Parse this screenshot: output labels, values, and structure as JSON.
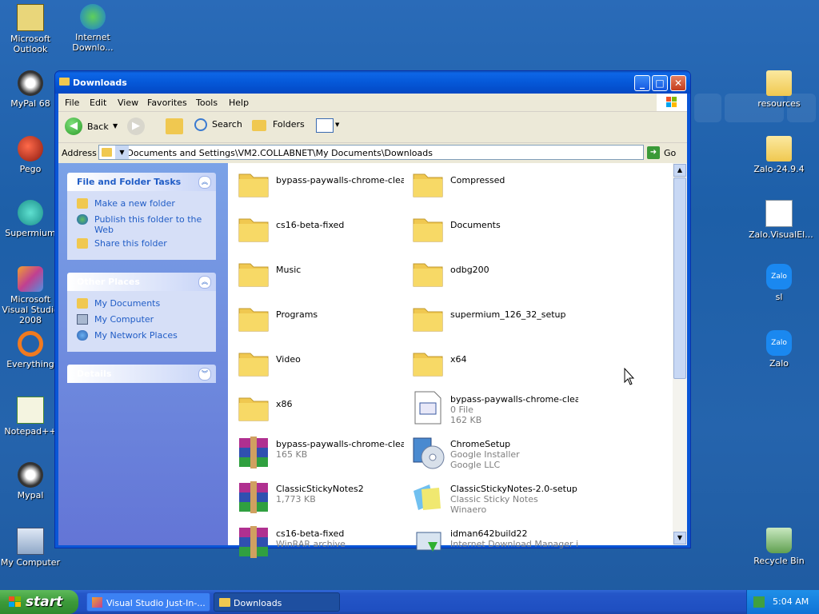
{
  "desktop": {
    "icons_left": [
      {
        "label": "Microsoft Outlook"
      },
      {
        "label": "Internet Downlo..."
      },
      {
        "label": "MyPal 68"
      },
      {
        "label": "Pego"
      },
      {
        "label": "Supermium"
      },
      {
        "label": "Microsoft Visual Studio 2008"
      },
      {
        "label": "Everything"
      },
      {
        "label": "Notepad++"
      },
      {
        "label": "Mypal"
      },
      {
        "label": "My Computer"
      }
    ],
    "icons_right": [
      {
        "label": "resources"
      },
      {
        "label": "Zalo-24.9.4"
      },
      {
        "label": "Zalo.VisualEl..."
      },
      {
        "label": "sl"
      },
      {
        "label": "Zalo"
      },
      {
        "label": "Recycle Bin"
      }
    ],
    "zalo_badge": "Zalo"
  },
  "window": {
    "title": "Downloads",
    "buttons": {
      "minimize": "_",
      "maximize": "□",
      "close": "✕"
    },
    "menu": [
      "File",
      "Edit",
      "View",
      "Favorites",
      "Tools",
      "Help"
    ],
    "toolbar": {
      "back": "Back",
      "search": "Search",
      "folders": "Folders"
    },
    "address": {
      "label": "Address",
      "value": "E:\\Documents and Settings\\VM2.COLLABNET\\My Documents\\Downloads",
      "go": "Go"
    },
    "tasks": {
      "file_folder": {
        "title": "File and Folder Tasks",
        "items": [
          "Make a new folder",
          "Publish this folder to the Web",
          "Share this folder"
        ]
      },
      "other_places": {
        "title": "Other Places",
        "items": [
          "My Documents",
          "My Computer",
          "My Network Places"
        ]
      },
      "details": {
        "title": "Details"
      }
    },
    "items": [
      {
        "name": "bypass-paywalls-chrome-clea...",
        "type": "folder"
      },
      {
        "name": "Compressed",
        "type": "folder"
      },
      {
        "name": "cs16-beta-fixed",
        "type": "folder"
      },
      {
        "name": "Documents",
        "type": "folder"
      },
      {
        "name": "Music",
        "type": "folder"
      },
      {
        "name": "odbg200",
        "type": "folder"
      },
      {
        "name": "Programs",
        "type": "folder"
      },
      {
        "name": "supermium_126_32_setup",
        "type": "folder"
      },
      {
        "name": "Video",
        "type": "folder"
      },
      {
        "name": "x64",
        "type": "folder"
      },
      {
        "name": "x86",
        "type": "folder"
      },
      {
        "name": "bypass-paywalls-chrome-clea...",
        "type": "file",
        "l1": "0 File",
        "l2": "162 KB"
      },
      {
        "name": "bypass-paywalls-chrome-clea...",
        "type": "rar",
        "l1": "165 KB",
        "l2": ""
      },
      {
        "name": "ChromeSetup",
        "type": "setup",
        "l1": "Google Installer",
        "l2": "Google LLC"
      },
      {
        "name": "ClassicStickyNotes2",
        "type": "rar",
        "l1": "1,773 KB",
        "l2": ""
      },
      {
        "name": "ClassicStickyNotes-2.0-setup",
        "type": "setup2",
        "l1": "Classic Sticky Notes",
        "l2": "Winaero"
      },
      {
        "name": "cs16-beta-fixed",
        "type": "rar",
        "l1": "WinRAR archive",
        "l2": ""
      },
      {
        "name": "idman642build22",
        "type": "setup3",
        "l1": "Internet Download Manager in...",
        "l2": ""
      }
    ]
  },
  "taskbar": {
    "start": "start",
    "buttons": [
      "Visual Studio Just-In-...",
      "Downloads"
    ],
    "time": "5:04 AM"
  },
  "colors": {
    "accent": "#215dc6",
    "titlebar": "#0558d8",
    "desktop": "#2564ad",
    "folder": "#f7d966"
  }
}
